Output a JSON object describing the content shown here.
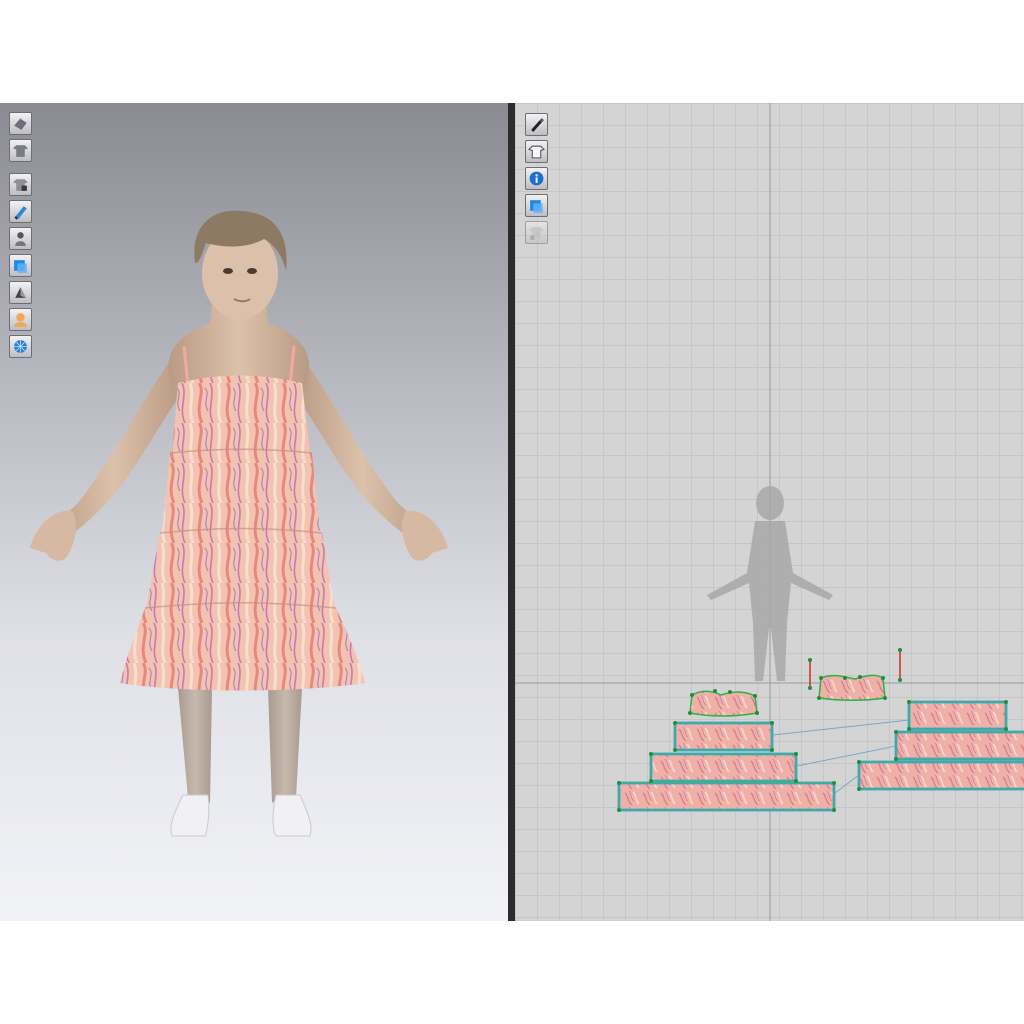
{
  "app": {
    "panels": [
      "3d-view",
      "2d-pattern-view"
    ]
  },
  "toolbar_3d": {
    "tools": [
      {
        "icon": "camera-view-icon"
      },
      {
        "icon": "garment-display-icon"
      },
      {
        "icon": "texture-display-icon"
      },
      {
        "icon": "paint-brush-icon"
      },
      {
        "icon": "avatar-display-icon"
      },
      {
        "icon": "cloth-3d-icon"
      },
      {
        "icon": "surface-render-icon"
      },
      {
        "icon": "avatar-skin-icon"
      },
      {
        "icon": "globe-environment-icon"
      }
    ]
  },
  "toolbar_2d": {
    "tools": [
      {
        "icon": "pen-select-icon"
      },
      {
        "icon": "shirt-visibility-icon"
      },
      {
        "icon": "info-icon"
      },
      {
        "icon": "pattern-texture-icon"
      },
      {
        "icon": "garment-lock-icon"
      }
    ]
  },
  "avatar": {
    "dress_colors": [
      "#f0b7a6",
      "#e8a093",
      "#c77bb0",
      "#f5d2c0"
    ],
    "skin_color": "#d8b9a1",
    "hair_color": "#8d7a62"
  },
  "pattern_pieces": {
    "count": 10,
    "outline_color": "#5aa7e0",
    "seam_color": "#2bb34a"
  }
}
